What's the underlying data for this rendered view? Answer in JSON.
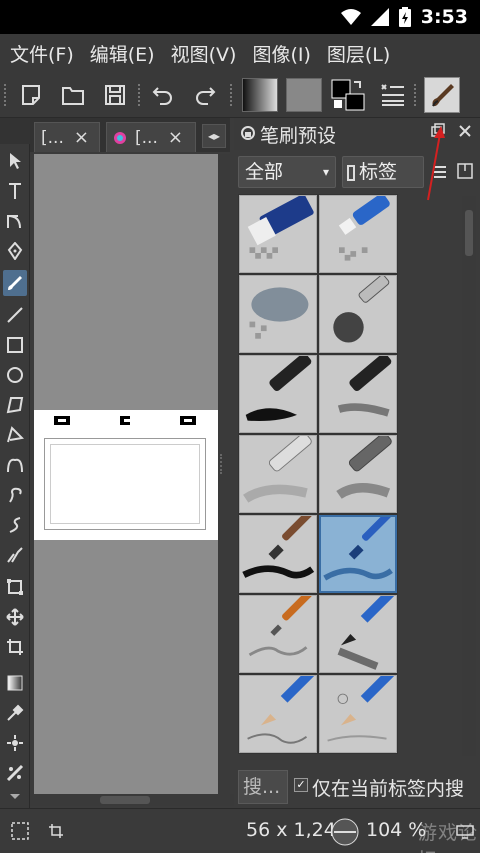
{
  "status_bar": {
    "time": "3:53"
  },
  "menu": {
    "file": "文件(F)",
    "edit": "编辑(E)",
    "view": "视图(V)",
    "image": "图像(I)",
    "layer": "图层(L)"
  },
  "tabs": [
    {
      "label": "[...",
      "close": "×"
    },
    {
      "label": "[...",
      "close": "×"
    }
  ],
  "docker": {
    "title": "笔刷预设",
    "filter_value": "全部",
    "tag_button": "标签",
    "search_placeholder": "搜...",
    "checkbox_label": "仅在当前标签内搜"
  },
  "brush_presets": [
    {
      "name": "eraser-block"
    },
    {
      "name": "eraser-pen"
    },
    {
      "name": "blender-soft"
    },
    {
      "name": "airbrush"
    },
    {
      "name": "ink-pen-black"
    },
    {
      "name": "ink-pen-gray"
    },
    {
      "name": "marker-light"
    },
    {
      "name": "marker-dark"
    },
    {
      "name": "paint-brush-round"
    },
    {
      "name": "paint-brush-selected"
    },
    {
      "name": "bristle-brush"
    },
    {
      "name": "pencil-charcoal"
    },
    {
      "name": "pencil-blue"
    },
    {
      "name": "pencil-sketch"
    }
  ],
  "bottom": {
    "coordinates": "56 x 1,24",
    "zoom": "104 %"
  },
  "watermark": "游戏论坛",
  "colors": {
    "accent": "#3a6ea5",
    "selected_brush_bg": "#8ab2d4",
    "annotation_arrow": "#d42020"
  }
}
